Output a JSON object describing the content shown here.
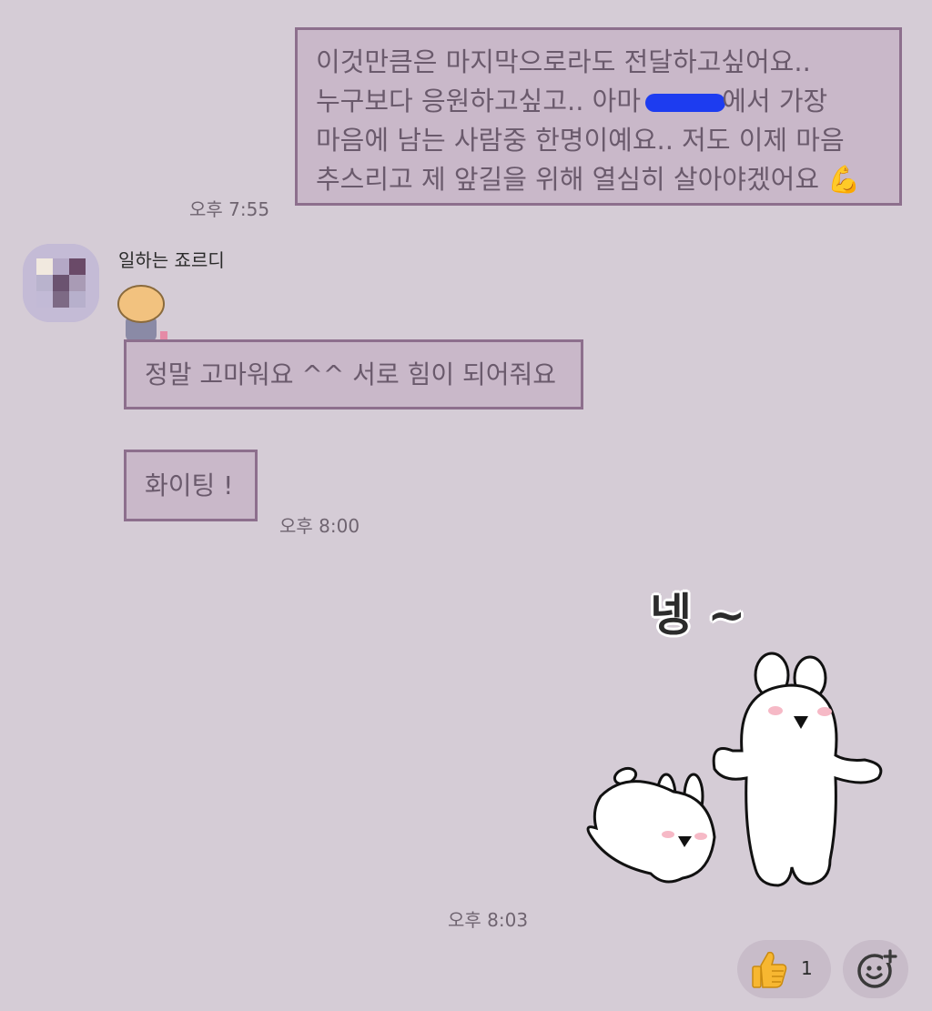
{
  "messages": {
    "outgoing_1": {
      "lines": [
        "이것만큼은 마지막으로라도 전달하고싶어요..",
        "누구보다 응원하고싶고..  아마 ",
        "에서 가장",
        "마음에 남는 사람중 한명이예요..  저도 이제 마음",
        "추스리고 제 앞길을 위해 열심히 살아야겠어요 💪"
      ],
      "time": "오후 7:55"
    },
    "incoming": {
      "sender": "일하는 죠르디",
      "message_1": "정말 고마워요 ^^ 서로 힘이 되어줘요",
      "message_2": "화이팅 !",
      "time": "오후 8:00"
    },
    "sticker": {
      "caption": "넹 ~",
      "time": "오후 8:03"
    }
  },
  "reactions": {
    "thumbs_up_icon": "👍",
    "thumbs_up_count": "1",
    "add_reaction_icon": "smiley-plus-icon"
  },
  "colors": {
    "background": "#d5ccd6",
    "bubble_fill": "#c9b8c9",
    "bubble_border": "#8d6f8d",
    "text": "#6a5a6c",
    "redaction": "#1d3cf0"
  }
}
